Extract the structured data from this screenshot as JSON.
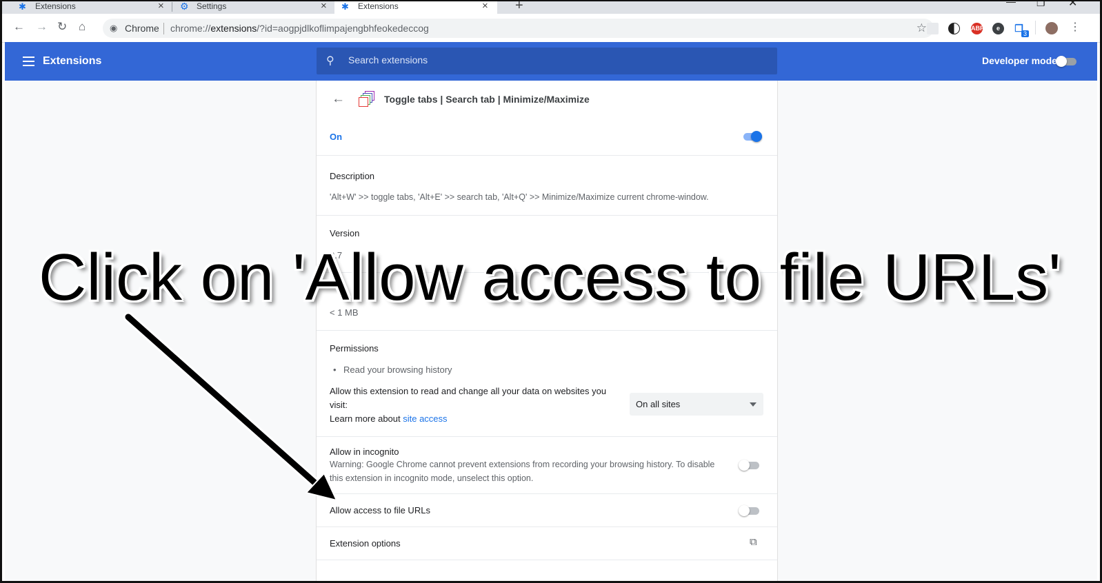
{
  "browser": {
    "tabs": [
      {
        "label": "Extensions",
        "icon": "puzzle-icon"
      },
      {
        "label": "Settings",
        "icon": "gear-icon"
      },
      {
        "label": "Extensions",
        "icon": "puzzle-icon",
        "active": true
      }
    ],
    "omnibox": {
      "site_label": "Chrome",
      "url_prefix": "chrome://",
      "url_host": "extensions",
      "url_rest": "/?id=aogpjdlkoflimpajengbhfeokedeccog"
    },
    "extension_icons": [
      "adblock-icon",
      "extension-icon",
      "avatar"
    ],
    "badge_count": "3"
  },
  "header": {
    "title": "Extensions",
    "search_placeholder": "Search extensions",
    "dev_mode_label": "Developer mode",
    "dev_mode_on": false
  },
  "detail": {
    "name": "Toggle tabs | Search tab | Minimize/Maximize",
    "status_label": "On",
    "enabled": true,
    "description_label": "Description",
    "description": "'Alt+W' >> toggle tabs, 'Alt+E' >> search tab, 'Alt+Q' >> Minimize/Maximize current chrome-window.",
    "version_label": "Version",
    "version": "2.7",
    "size": "< 1 MB",
    "permissions_label": "Permissions",
    "permissions": [
      "Read your browsing history"
    ],
    "site_access_text_1": "Allow this extension to read and change all your data on websites you",
    "site_access_text_2": "visit:",
    "learn_more_prefix": "Learn more about ",
    "learn_more_link": "site access",
    "site_access_value": "On all sites",
    "incognito_label": "Allow in incognito",
    "incognito_warning_1": "Warning: Google Chrome cannot prevent extensions from recording your browsing history. To disable",
    "incognito_warning_2": "this extension in incognito mode, unselect this option.",
    "file_urls_label": "Allow access to file URLs",
    "options_label": "Extension options"
  },
  "overlay": {
    "instruction": "Click on 'Allow access to file URLs'",
    "color": "#000000"
  },
  "colors": {
    "header_blue": "#3367d6",
    "accent": "#1a73e8"
  }
}
